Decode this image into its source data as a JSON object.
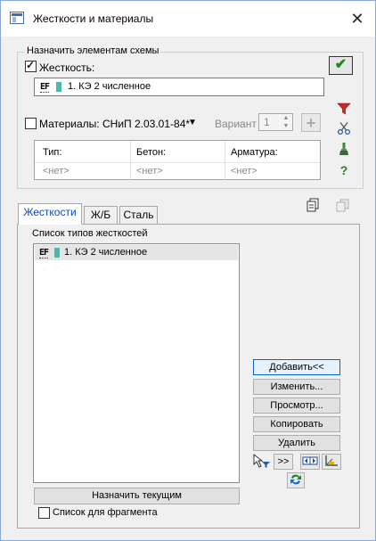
{
  "window": {
    "title": "Жесткости и материалы",
    "close_glyph": "✕"
  },
  "assign_group": {
    "label": "Назначить элементам схемы",
    "stiffness_checkbox": {
      "label": "Жесткость:",
      "checked": true
    },
    "stiffness_value": {
      "prefix": "EF",
      "text": "1. КЭ 2 численное"
    },
    "materials_checkbox": {
      "label": "Материалы:",
      "checked": false
    },
    "norm": {
      "value": "СНиП 2.03.01-84*",
      "caret": "▼"
    },
    "variant": {
      "label": "Вариант",
      "value": "1"
    },
    "add_material_glyph": "+",
    "materials_table": {
      "columns": [
        "Тип:",
        "Бетон:",
        "Арматура:"
      ],
      "values": [
        "<нет>",
        "<нет>",
        "<нет>"
      ]
    },
    "apply_glyph": "✔"
  },
  "side_icons": [
    "filter-icon",
    "scissors-icon",
    "brush-icon",
    "help-icon"
  ],
  "help_glyph": "?",
  "tabs": [
    "Жесткости",
    "Ж/Б",
    "Сталь"
  ],
  "stiffness_tab": {
    "list_title": "Список типов жесткостей",
    "items": [
      {
        "prefix": "EF",
        "text": "1. КЭ 2 численное"
      }
    ],
    "buttons": {
      "add": "Добавить<<",
      "edit": "Изменить...",
      "view": "Просмотр...",
      "copy": "Копировать",
      "delete": "Удалить"
    },
    "forward_label": ">>",
    "assign_current": "Назначить текущим",
    "fragment_checkbox": {
      "label": "Список для фрагмента",
      "checked": false
    }
  },
  "colors": {
    "accent_tab": "#0b4ab8",
    "teal": "#4fb8ad",
    "check_green": "#1a8a1a",
    "primary_border": "#0a64c8"
  }
}
